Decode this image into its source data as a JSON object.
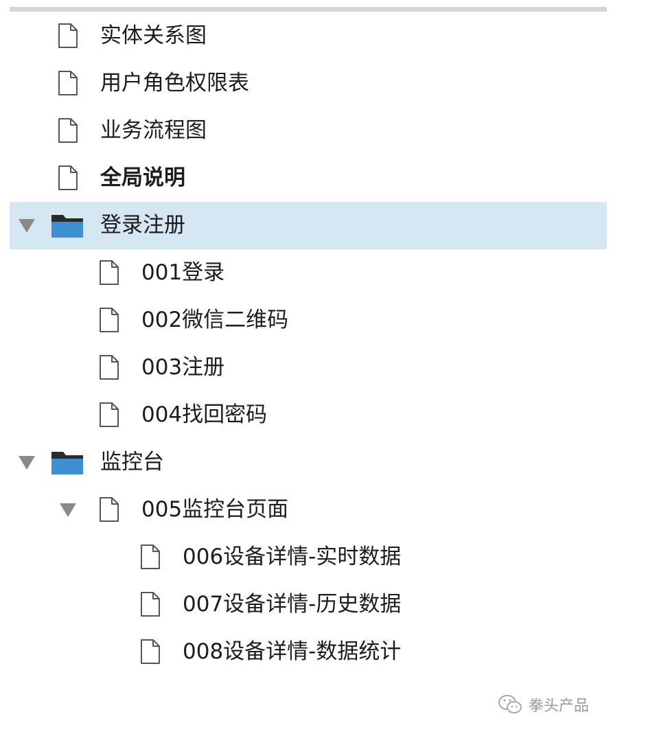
{
  "tree": {
    "items": [
      {
        "label": "实体关系图",
        "type": "page",
        "level": 0,
        "expander": "none",
        "bold": false,
        "selected": false
      },
      {
        "label": "用户角色权限表",
        "type": "page",
        "level": 0,
        "expander": "none",
        "bold": false,
        "selected": false
      },
      {
        "label": "业务流程图",
        "type": "page",
        "level": 0,
        "expander": "none",
        "bold": false,
        "selected": false
      },
      {
        "label": "全局说明",
        "type": "page",
        "level": 0,
        "expander": "none",
        "bold": true,
        "selected": false
      },
      {
        "label": "登录注册",
        "type": "folder",
        "level": 0,
        "expander": "expanded",
        "bold": false,
        "selected": true
      },
      {
        "label": "001登录",
        "type": "page",
        "level": 1,
        "expander": "none",
        "bold": false,
        "selected": false
      },
      {
        "label": "002微信二维码",
        "type": "page",
        "level": 1,
        "expander": "none",
        "bold": false,
        "selected": false
      },
      {
        "label": "003注册",
        "type": "page",
        "level": 1,
        "expander": "none",
        "bold": false,
        "selected": false
      },
      {
        "label": "004找回密码",
        "type": "page",
        "level": 1,
        "expander": "none",
        "bold": false,
        "selected": false
      },
      {
        "label": "监控台",
        "type": "folder",
        "level": 0,
        "expander": "expanded",
        "bold": false,
        "selected": false
      },
      {
        "label": "005监控台页面",
        "type": "page",
        "level": 1,
        "expander": "expanded",
        "bold": false,
        "selected": false
      },
      {
        "label": "006设备详情-实时数据",
        "type": "page",
        "level": 2,
        "expander": "none",
        "bold": false,
        "selected": false
      },
      {
        "label": "007设备详情-历史数据",
        "type": "page",
        "level": 2,
        "expander": "none",
        "bold": false,
        "selected": false
      },
      {
        "label": "008设备详情-数据统计",
        "type": "page",
        "level": 2,
        "expander": "none",
        "bold": false,
        "selected": false
      }
    ]
  },
  "watermark": {
    "text": "拳头产品",
    "icon": "wechat-icon"
  },
  "colors": {
    "selected_row": "#d4e7f3",
    "folder": "#3d8fd1",
    "expander": "#8a8a8a",
    "top_bar": "#d6d6d6"
  }
}
